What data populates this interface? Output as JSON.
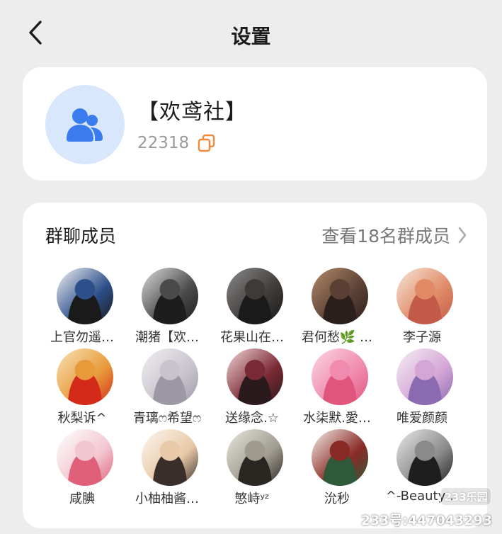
{
  "nav": {
    "title": "设置"
  },
  "group": {
    "name": "【欢鸢社】",
    "id": "22318"
  },
  "members": {
    "title": "群聊成员",
    "view_all": "查看18名群成员",
    "list": [
      {
        "name": "上官勿遥…",
        "avatar": [
          "#f4f4f4",
          "#2d4f8a",
          "#1a1a1a"
        ]
      },
      {
        "name": "潮猪【欢…",
        "avatar": [
          "#dcdcdc",
          "#4a4a4a",
          "#1d1d1d"
        ]
      },
      {
        "name": "花果山在…",
        "avatar": [
          "#8b8b8b",
          "#3e3a38",
          "#1a1a1a"
        ]
      },
      {
        "name": "君何愁🌿 …",
        "avatar": [
          "#b28a6a",
          "#5a4034",
          "#2a1f1c"
        ]
      },
      {
        "name": "李子源",
        "avatar": [
          "#f6e6d8",
          "#e08a66",
          "#c45a4a"
        ]
      },
      {
        "name": "秋梨诉^",
        "avatar": [
          "#f8e2b8",
          "#e89a3a",
          "#d42a1a"
        ]
      },
      {
        "name": "青璃ෆ希望ෆ",
        "avatar": [
          "#f0edf2",
          "#c8c4cc",
          "#9e98a6"
        ]
      },
      {
        "name": "送缘念.☆",
        "avatar": [
          "#f2d6d8",
          "#7a2a34",
          "#2a1a1e"
        ]
      },
      {
        "name": "水柒默.愛…",
        "avatar": [
          "#fbd6e2",
          "#f08aae",
          "#e0557e"
        ]
      },
      {
        "name": "唯爱颜颜",
        "avatar": [
          "#f6eef4",
          "#d4a6d6",
          "#8a6ab0"
        ]
      },
      {
        "name": "咸腆",
        "avatar": [
          "#ffffff",
          "#f2c6d0",
          "#e0607a"
        ]
      },
      {
        "name": "小柚柚酱…",
        "avatar": [
          "#fdf6ee",
          "#e8c9a8",
          "#3a2e2a"
        ]
      },
      {
        "name": "慜峙ʸᶻ",
        "avatar": [
          "#e8e6de",
          "#9e9a8e",
          "#2a2622"
        ]
      },
      {
        "name": "沇秒",
        "avatar": [
          "#f6f0ea",
          "#8a2a26",
          "#2e5a3a"
        ]
      },
      {
        "name": "^-Beauty…",
        "avatar": [
          "#e8e8e8",
          "#8a8a8a",
          "#1e1e1e"
        ]
      }
    ]
  },
  "watermark": {
    "badge": "233乐园",
    "text": "233号:447043293"
  },
  "colors": {
    "accent_orange": "#f08a3a",
    "group_icon_blue": "#3a7cee",
    "group_avatar_bg": "#d8e7fb"
  }
}
